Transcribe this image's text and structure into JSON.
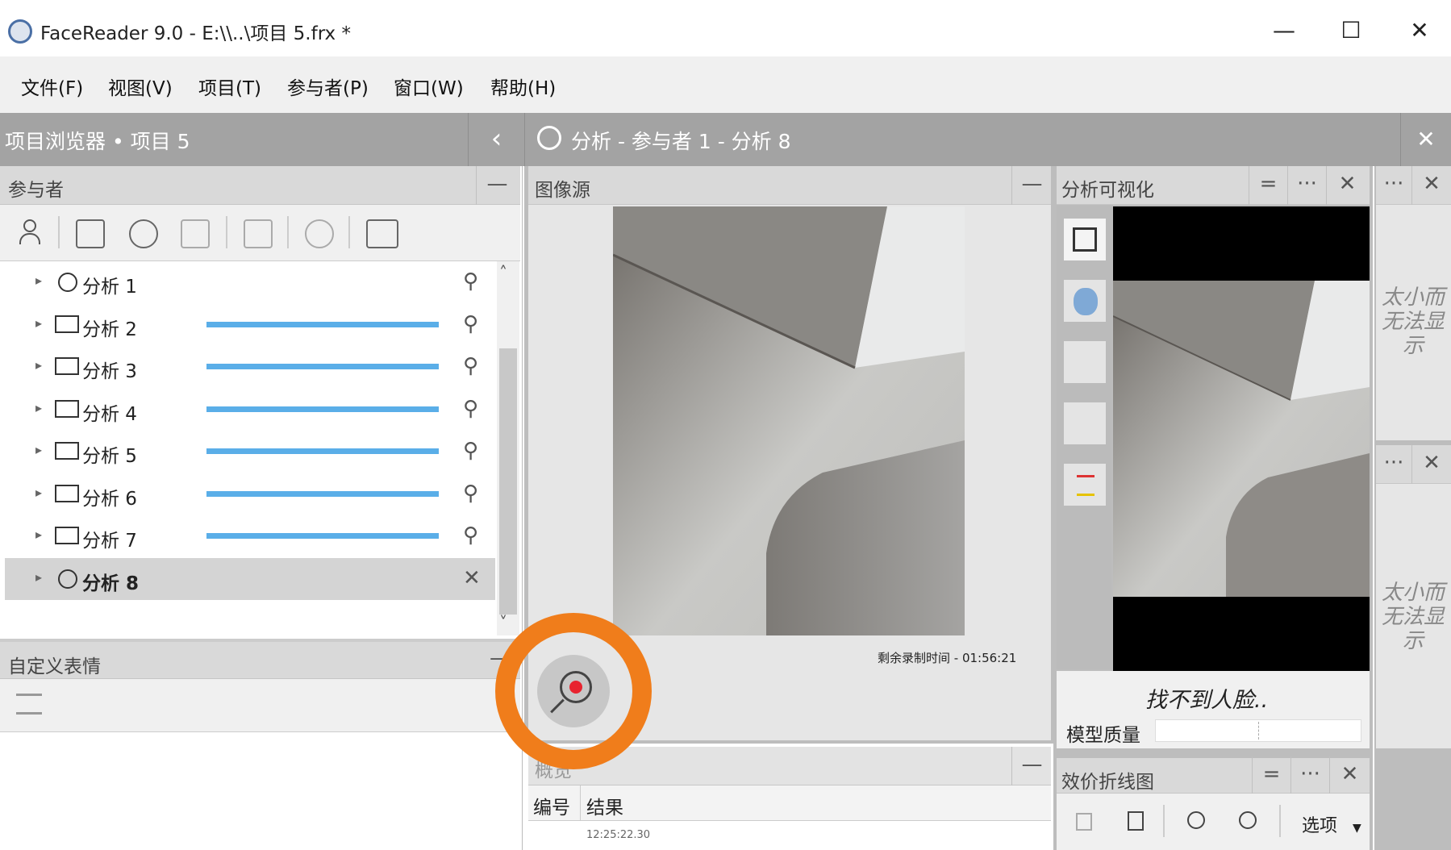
{
  "window": {
    "title": "FaceReader 9.0 - E:\\\\..\\项目 5.frx *",
    "minimize": "—",
    "maximize": "☐",
    "close": "✕"
  },
  "menu": [
    "文件(F)",
    "视图(V)",
    "项目(T)",
    "参与者(P)",
    "窗口(W)",
    "帮助(H)"
  ],
  "project_browser": {
    "title": "项目浏览器 • 项目 5",
    "collapse": "‹"
  },
  "participants": {
    "title": "参与者",
    "minimize": "—",
    "rows": [
      {
        "label": "分析 1",
        "icon": "webcam-icon",
        "bar": false
      },
      {
        "label": "分析 2",
        "icon": "film-icon",
        "bar": true
      },
      {
        "label": "分析 3",
        "icon": "film-icon",
        "bar": true
      },
      {
        "label": "分析 4",
        "icon": "film-icon",
        "bar": true
      },
      {
        "label": "分析 5",
        "icon": "film-icon",
        "bar": true
      },
      {
        "label": "分析 6",
        "icon": "film-icon",
        "bar": true
      },
      {
        "label": "分析 7",
        "icon": "film-icon",
        "bar": true
      },
      {
        "label": "分析 8",
        "icon": "webcam-icon",
        "bar": false,
        "selected": true
      }
    ]
  },
  "custom_expressions": {
    "title": "自定义表情",
    "minimize": "—"
  },
  "analysis_header": {
    "title": "分析 - 参与者 1 - 分析 8",
    "close": "✕"
  },
  "image_source": {
    "title": "图像源",
    "minimize": "—",
    "remaining_time": "剩余录制时间 - 01:56:21"
  },
  "overview": {
    "title": "概览",
    "minimize": "—",
    "columns": [
      "编号",
      "结果"
    ],
    "first_cell": "12:25:22.30"
  },
  "analysis_vis": {
    "title": "分析可视化",
    "eq": "=",
    "more": "···",
    "close": "✕",
    "status": "找不到人脸..",
    "model_quality_label": "模型质量"
  },
  "right_strip": {
    "more": "···",
    "close": "✕",
    "too_small": "太小而无法显示"
  },
  "valence_chart": {
    "title": "效价折线图",
    "eq": "=",
    "more": "···",
    "close": "✕",
    "options": "选项"
  },
  "colors": {
    "accent_orange": "#f07d1b",
    "progress_blue": "#5aaee8",
    "record_red": "#e8232f"
  }
}
